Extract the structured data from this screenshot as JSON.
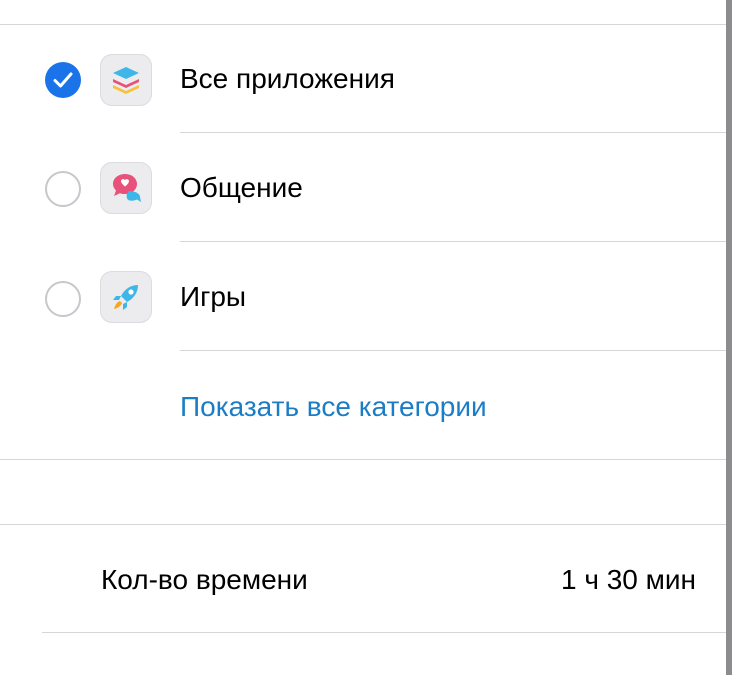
{
  "categories": [
    {
      "label": "Все приложения",
      "selected": true,
      "icon": "stack-layers-icon"
    },
    {
      "label": "Общение",
      "selected": false,
      "icon": "chat-bubbles-icon"
    },
    {
      "label": "Игры",
      "selected": false,
      "icon": "rocket-icon"
    }
  ],
  "show_all_link": "Показать все категории",
  "time_limit": {
    "label": "Кол-во времени",
    "value": "1 ч 30 мин"
  },
  "colors": {
    "accent": "#1a73e8",
    "link": "#1b7dc6",
    "separator": "#d6d6d9"
  }
}
